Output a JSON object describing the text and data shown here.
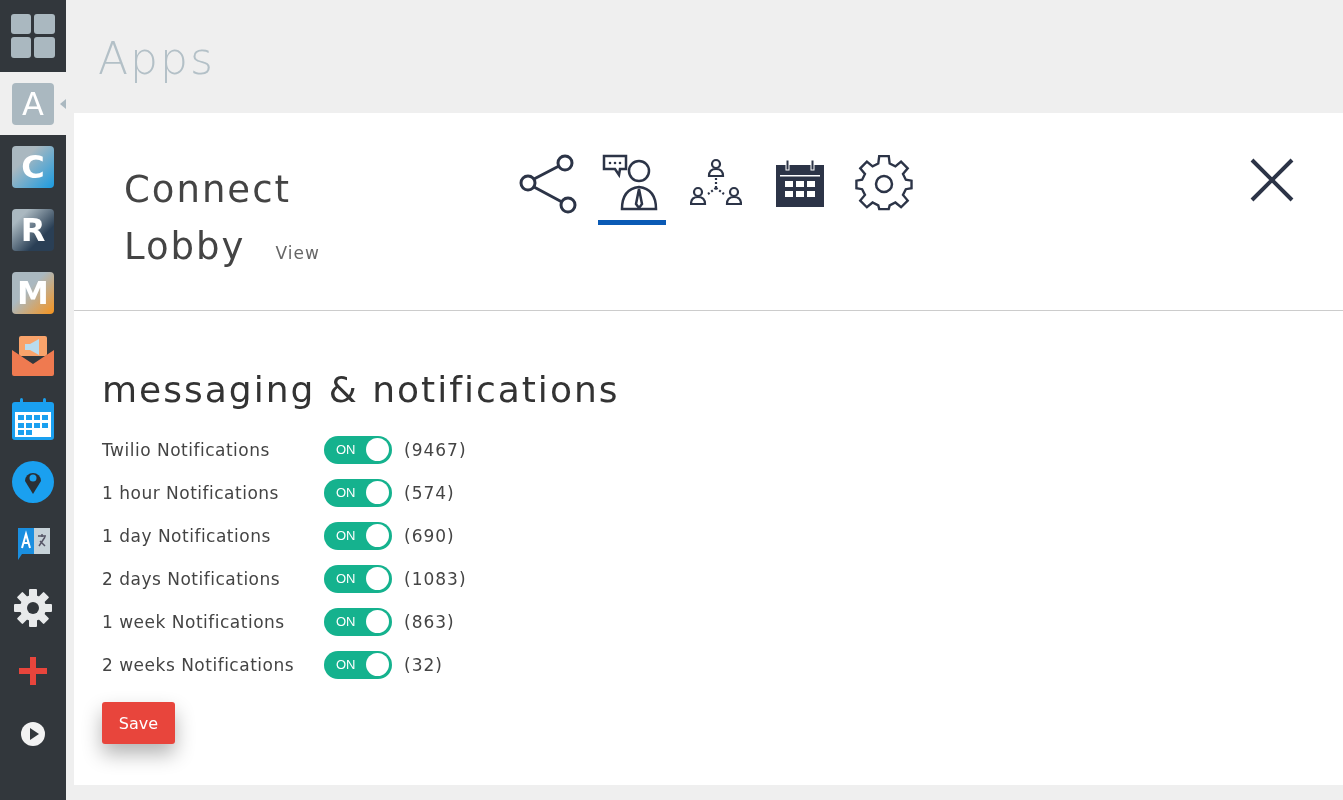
{
  "sidebar": {
    "items": [
      {
        "kind": "grid",
        "selected": false
      },
      {
        "kind": "letter",
        "letter": "A",
        "selected": true
      },
      {
        "kind": "letter",
        "letter": "C",
        "selected": false
      },
      {
        "kind": "letter",
        "letter": "R",
        "selected": false
      },
      {
        "kind": "letter",
        "letter": "M",
        "selected": false
      },
      {
        "kind": "megaphone",
        "selected": false
      },
      {
        "kind": "calendar",
        "selected": false
      },
      {
        "kind": "pin",
        "selected": false
      },
      {
        "kind": "translate",
        "selected": false
      },
      {
        "kind": "gear",
        "selected": false
      },
      {
        "kind": "plus",
        "selected": false
      },
      {
        "kind": "play",
        "selected": false
      }
    ]
  },
  "page_title": "Apps",
  "panel": {
    "title_line_1": "Connect",
    "title_line_2": "Lobby",
    "view_link": "View",
    "tabs": [
      {
        "kind": "share",
        "selected": false
      },
      {
        "kind": "person-chat",
        "selected": true
      },
      {
        "kind": "network",
        "selected": false
      },
      {
        "kind": "calendar",
        "selected": false
      },
      {
        "kind": "gear",
        "selected": false
      }
    ],
    "section_title": "messaging & notifications",
    "notifications": [
      {
        "label": "Twilio Notifications",
        "on": true,
        "toggle_text": "ON",
        "count": "(9467)"
      },
      {
        "label": "1 hour Notifications",
        "on": true,
        "toggle_text": "ON",
        "count": "(574)"
      },
      {
        "label": "1 day Notifications",
        "on": true,
        "toggle_text": "ON",
        "count": "(690)"
      },
      {
        "label": "2 days Notifications",
        "on": true,
        "toggle_text": "ON",
        "count": "(1083)"
      },
      {
        "label": "1 week Notifications",
        "on": true,
        "toggle_text": "ON",
        "count": "(863)"
      },
      {
        "label": "2 weeks Notifications",
        "on": true,
        "toggle_text": "ON",
        "count": "(32)"
      }
    ],
    "save_button": "Save"
  }
}
